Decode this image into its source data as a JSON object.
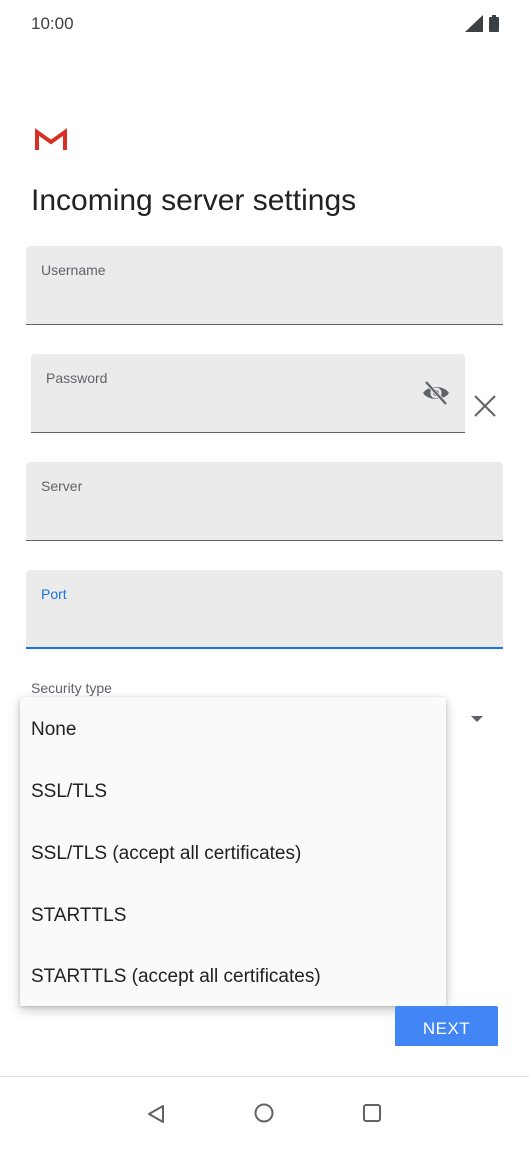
{
  "status_bar": {
    "time": "10:00"
  },
  "page": {
    "title": "Incoming server settings"
  },
  "fields": {
    "username_label": "Username",
    "password_label": "Password",
    "server_label": "Server",
    "port_label": "Port",
    "security_type_label": "Security type"
  },
  "security_menu": {
    "options": [
      "None",
      "SSL/TLS",
      "SSL/TLS (accept all certificates)",
      "STARTTLS",
      "STARTTLS (accept all certificates)"
    ]
  },
  "buttons": {
    "next_label": "NEXT"
  },
  "icons": {
    "gmail": "gmail-logo",
    "password_toggle": "visibility-off-icon",
    "clear": "close-icon",
    "nav_back": "back-icon",
    "nav_home": "home-icon",
    "nav_recents": "recents-icon"
  },
  "colors": {
    "accent": "#1a73e8",
    "button": "#4285f4"
  }
}
